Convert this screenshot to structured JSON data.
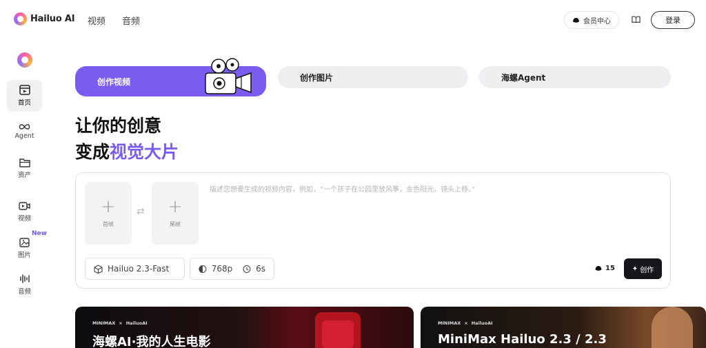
{
  "header": {
    "brand": "Hailuo AI",
    "nav": [
      "视频",
      "音频"
    ],
    "member_center": "会员中心",
    "login": "登录"
  },
  "sidebar": {
    "items": [
      {
        "label": "首页",
        "icon": "home-icon"
      },
      {
        "label": "Agent",
        "icon": "infinity-icon"
      },
      {
        "label": "资产",
        "icon": "folder-icon"
      },
      {
        "label": "视频",
        "icon": "video-icon"
      },
      {
        "label": "图片",
        "icon": "image-icon"
      },
      {
        "label": "音频",
        "icon": "audio-wave-icon"
      }
    ],
    "new_badge": "New"
  },
  "tabs": [
    "创作视频",
    "创作图片",
    "海螺Agent"
  ],
  "headline": {
    "line1": "让你的创意",
    "line2_prefix": "变成",
    "line2_accent": "视觉大片"
  },
  "prompt": {
    "first_frame": "首帧",
    "last_frame": "尾帧",
    "placeholder": "描述您想要生成的视频内容，例如，“一个孩子在公园里放风筝，金色阳光，镜头上移。”",
    "model": "Hailuo 2.3-Fast",
    "resolution": "768p",
    "duration": "6s",
    "credits": "15",
    "create": "创作"
  },
  "cards": [
    {
      "brand_left": "MINIMAX",
      "brand_right": "HailuoAI",
      "title": "海螺AI·我的人生电影"
    },
    {
      "brand_left": "MINIMAX",
      "brand_right": "HailuoAI",
      "title": "MiniMax Hailuo 2.3 / 2.3"
    }
  ],
  "colors": {
    "accent": "#7b5cf0",
    "dark_button": "#16161a"
  }
}
